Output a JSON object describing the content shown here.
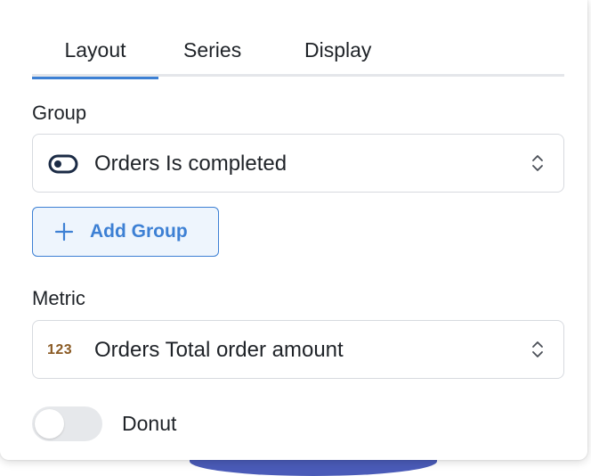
{
  "tabs": [
    {
      "label": "Layout",
      "active": true
    },
    {
      "label": "Series",
      "active": false
    },
    {
      "label": "Display",
      "active": false
    }
  ],
  "group": {
    "label": "Group",
    "selected": "Orders Is completed",
    "icon": "toggle-icon",
    "add_button_label": "Add Group"
  },
  "metric": {
    "label": "Metric",
    "selected": "Orders Total order amount",
    "icon_text": "123"
  },
  "donut": {
    "label": "Donut",
    "enabled": false
  },
  "colors": {
    "accent": "#3d80d4",
    "metric_icon": "#8a5a24",
    "chart_series_1": "#4a67c2",
    "chart_series_2": "#ef8550"
  }
}
